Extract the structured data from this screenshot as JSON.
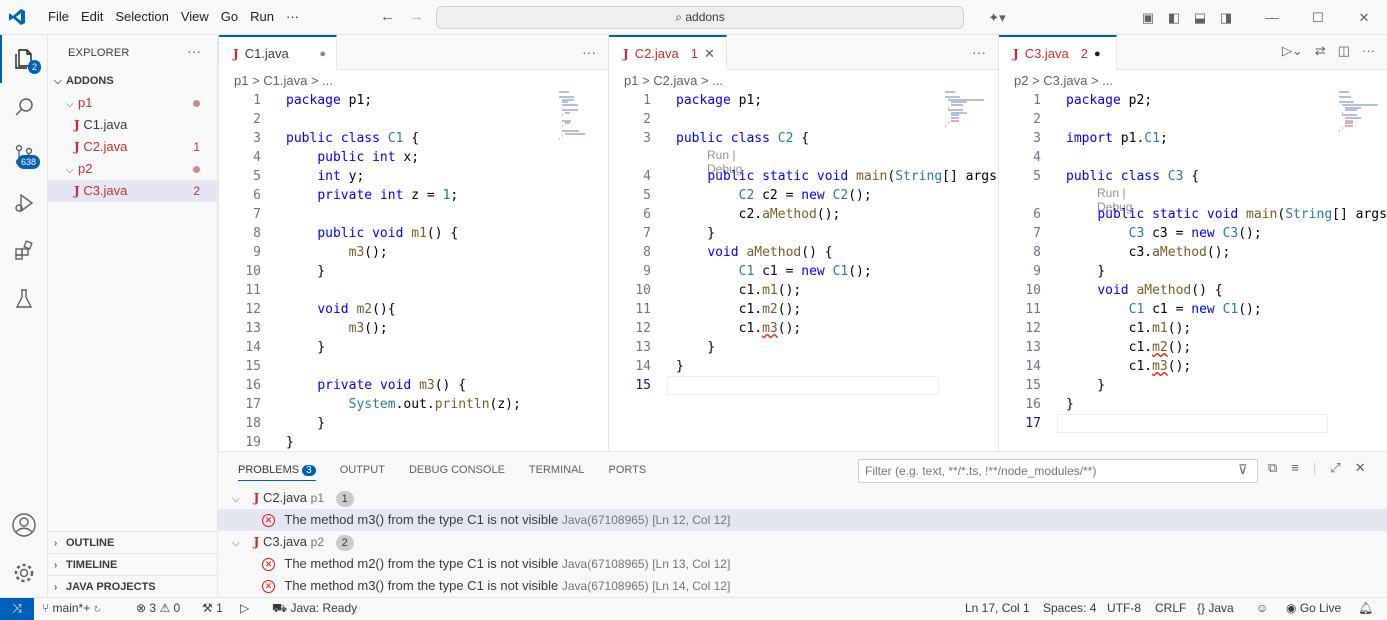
{
  "menu": [
    "File",
    "Edit",
    "Selection",
    "View",
    "Go",
    "Run",
    "···"
  ],
  "search": {
    "text": "addons"
  },
  "activity": {
    "explorer_badge": "2",
    "scm_badge": "638"
  },
  "explorer": {
    "title": "EXPLORER",
    "root": "ADDONS",
    "items": [
      {
        "label": "p1"
      },
      {
        "label": "C1.java"
      },
      {
        "label": "C2.java",
        "count": "1"
      },
      {
        "label": "p2"
      },
      {
        "label": "C3.java",
        "count": "2"
      }
    ],
    "sections": [
      "OUTLINE",
      "TIMELINE",
      "JAVA PROJECTS"
    ]
  },
  "editors": [
    {
      "tab": "C1.java",
      "breadcrumb": "p1 > C1.java > ...",
      "lines": [
        "package p1;",
        "",
        "public class C1 {",
        "    public int x;",
        "    int y;",
        "    private int z = 1;",
        "",
        "    public void m1() {",
        "        m3();",
        "    }",
        "",
        "    void m2(){",
        "        m3();",
        "    }",
        "",
        "    private void m3() {",
        "        System.out.println(z);",
        "    }",
        "}"
      ]
    },
    {
      "tab": "C2.java",
      "tab_count": "1",
      "breadcrumb": "p1 > C2.java > ...",
      "codelens": "Run | Debug",
      "lines": [
        "package p1;",
        "",
        "public class C2 {",
        "    public static void main(String[] args) {",
        "        C2 c2 = new C2();",
        "        c2.aMethod();",
        "    }",
        "    void aMethod() {",
        "        C1 c1 = new C1();",
        "        c1.m1();",
        "        c1.m2();",
        "        c1.m3();",
        "    }",
        "}",
        ""
      ]
    },
    {
      "tab": "C3.java",
      "tab_count": "2",
      "breadcrumb": "p2 > C3.java > ...",
      "codelens": "Run | Debug",
      "lines": [
        "package p2;",
        "",
        "import p1.C1;",
        "",
        "public class C3 {",
        "    public static void main(String[] args) {",
        "        C3 c3 = new C3();",
        "        c3.aMethod();",
        "    }",
        "    void aMethod() {",
        "        C1 c1 = new C1();",
        "        c1.m1();",
        "        c1.m2();",
        "        c1.m3();",
        "    }",
        "}",
        ""
      ]
    }
  ],
  "panel": {
    "tabs": [
      "PROBLEMS",
      "OUTPUT",
      "DEBUG CONSOLE",
      "TERMINAL",
      "PORTS"
    ],
    "problems_badge": "3",
    "filter_placeholder": "Filter (e.g. text, **/*.ts, !**/node_modules/**)",
    "groups": [
      {
        "file": "C2.java",
        "folder": "p1",
        "count": "1",
        "items": [
          {
            "msg": "The method m3() from the type C1 is not visible",
            "src": "Java(67108965)",
            "loc": "[Ln 12, Col 12]"
          }
        ]
      },
      {
        "file": "C3.java",
        "folder": "p2",
        "count": "2",
        "items": [
          {
            "msg": "The method m2() from the type C1 is not visible",
            "src": "Java(67108965)",
            "loc": "[Ln 13, Col 12]"
          },
          {
            "msg": "The method m3() from the type C1 is not visible",
            "src": "Java(67108965)",
            "loc": "[Ln 14, Col 12]"
          }
        ]
      }
    ]
  },
  "status": {
    "branch": "main*+",
    "errors": "3",
    "warnings": "0",
    "ports": "1",
    "java": "Java: Ready",
    "position": "Ln 17, Col 1",
    "spaces": "Spaces: 4",
    "encoding": "UTF-8",
    "eol": "CRLF",
    "lang": "Java",
    "golive": "Go Live"
  },
  "colors": {
    "accent": "#005fb8",
    "error": "#e51400",
    "keyword": "#0000ff",
    "type": "#267f99"
  }
}
